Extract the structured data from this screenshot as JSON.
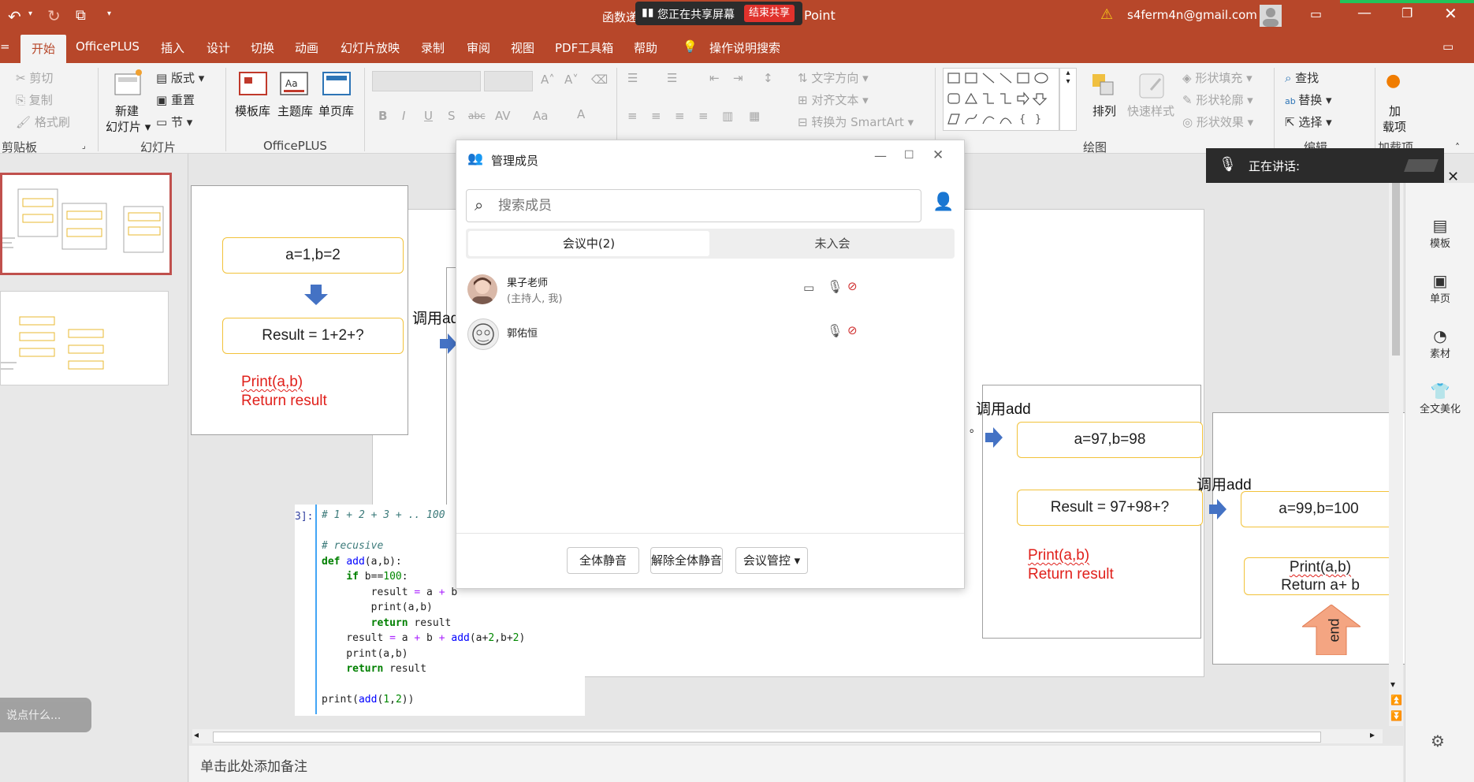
{
  "titlebar": {
    "title_left": "函数递",
    "title_right": "Point",
    "share_status": "您正在共享屏幕",
    "end_share": "结束共享",
    "account": "s4ferm4n@gmail.com"
  },
  "tabs": [
    "开始",
    "OfficePLUS",
    "插入",
    "设计",
    "切换",
    "动画",
    "幻灯片放映",
    "录制",
    "审阅",
    "视图",
    "PDF工具箱",
    "帮助"
  ],
  "tell_me": "操作说明搜索",
  "ribbon": {
    "clipboard": {
      "cut": "剪切",
      "copy": "复制",
      "format_painter": "格式刷",
      "group": "剪贴板"
    },
    "slides": {
      "new_slide_1": "新建",
      "new_slide_2": "幻灯片",
      "layout": "版式",
      "reset": "重置",
      "section": "节",
      "group": "幻灯片"
    },
    "officeplus": {
      "template_lib": "模板库",
      "theme_lib": "主题库",
      "single_page": "单页库",
      "group": "OfficePLUS"
    },
    "paragraph": {
      "text_direction": "文字方向",
      "align_text": "对齐文本",
      "convert_smartart": "转换为 SmartArt"
    },
    "drawing": {
      "arrange": "排列",
      "quick_styles": "快速样式",
      "shape_fill": "形状填充",
      "shape_outline": "形状轮廓",
      "shape_effects": "形状效果",
      "group": "绘图"
    },
    "editing": {
      "find": "查找",
      "replace": "替换",
      "select": "选择",
      "group": "编辑"
    },
    "addins": {
      "label_1": "加",
      "label_2": "载项",
      "group": "加载项"
    }
  },
  "speaking": {
    "label": "正在讲话:"
  },
  "dialog": {
    "title": "管理成员",
    "search_placeholder": "搜索成员",
    "tab_in_meeting": "会议中(2)",
    "tab_not_joined": "未入会",
    "members": [
      {
        "name": "果子老师",
        "role": "(主持人, 我)"
      },
      {
        "name": "郭佑恒",
        "role": ""
      }
    ],
    "btn_mute_all": "全体静音",
    "btn_unmute_all": "解除全体静音",
    "btn_meeting_control": "会议管控"
  },
  "slide": {
    "box1": "a=1,b=2",
    "box2": "Result = 1+2+?",
    "red1_l1": "Print(a,b)",
    "red1_l2": "Return result",
    "call_add_1": "调用ad",
    "call_add_2": "调用add",
    "dot": "。",
    "box3": "a=97,b=98",
    "box4": "Result = 97+98+?",
    "red2_l1": "Print(a,b)",
    "red2_l2": "Return result",
    "call_add_3": "调用add",
    "box5": "a=99,b=100",
    "box6_l1": "Print(a,b)",
    "box6_l2": "Return a+ b",
    "end": "end"
  },
  "code": {
    "prompt": "3]:",
    "lines": [
      "# 1 + 2 + 3 + .. 100",
      "",
      "# recusive",
      "def add(a,b):",
      "    if b==100:",
      "        result = a + b",
      "        print(a,b)",
      "        return result",
      "    result = a + b + add(a+2,b+2)",
      "    print(a,b)",
      "    return result",
      "",
      "print(add(1,2))"
    ]
  },
  "chat": {
    "placeholder": "说点什么..."
  },
  "right_pane": [
    "模板",
    "单页",
    "素材",
    "全文美化"
  ],
  "notes": {
    "placeholder": "单击此处添加备注"
  }
}
